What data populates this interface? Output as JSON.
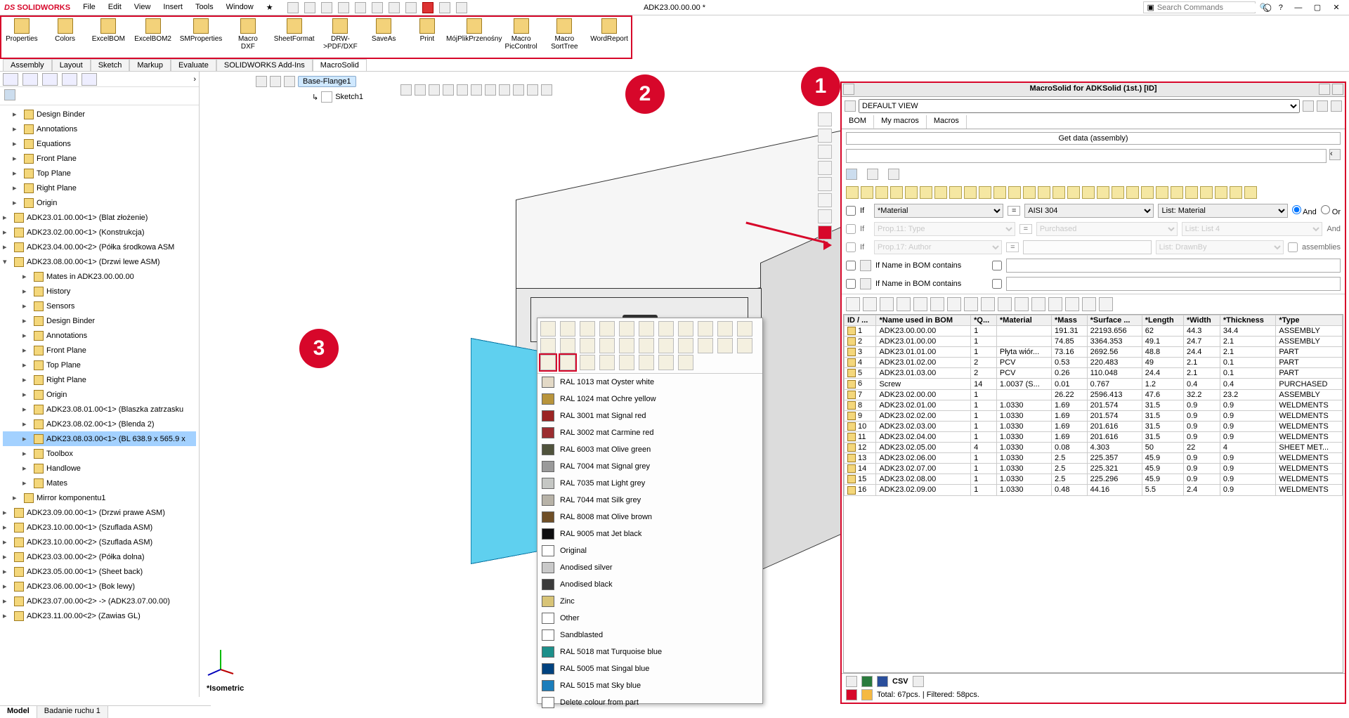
{
  "app": {
    "brand": "SOLIDWORKS",
    "menus": [
      "File",
      "Edit",
      "View",
      "Insert",
      "Tools",
      "Window"
    ],
    "docTitle": "ADK23.00.00.00 *",
    "searchPlaceholder": "Search Commands"
  },
  "macroToolbar": [
    "Properties",
    "Colors",
    "ExcelBOM",
    "ExcelBOM2",
    "SMProperties",
    "Macro DXF",
    "SheetFormat",
    "DRW->PDF/DXF",
    "SaveAs",
    "Print",
    "MójPlikPrzenośny",
    "Macro PicControl",
    "Macro SortTree",
    "WordReport"
  ],
  "cmdTabs": [
    "Assembly",
    "Layout",
    "Sketch",
    "Markup",
    "Evaluate",
    "SOLIDWORKS Add-Ins",
    "MacroSolid"
  ],
  "cmdTabActive": "MacroSolid",
  "breadcrumb": {
    "flange": "Base-Flange1",
    "sketch": "Sketch1"
  },
  "tree": [
    {
      "t": "Design Binder",
      "i": 1
    },
    {
      "t": "Annotations",
      "i": 1
    },
    {
      "t": "Equations",
      "i": 1
    },
    {
      "t": "Front Plane",
      "i": 1
    },
    {
      "t": "Top Plane",
      "i": 1
    },
    {
      "t": "Right Plane",
      "i": 1
    },
    {
      "t": "Origin",
      "i": 1
    },
    {
      "t": "ADK23.01.00.00<1> (Blat złożenie)",
      "i": 0
    },
    {
      "t": "ADK23.02.00.00<1> (Konstrukcja)",
      "i": 0
    },
    {
      "t": "ADK23.04.00.00<2> (Półka środkowa ASM",
      "i": 0
    },
    {
      "t": "ADK23.08.00.00<1> (Drzwi lewe ASM)",
      "i": 0,
      "open": true
    },
    {
      "t": "Mates in ADK23.00.00.00",
      "i": 2
    },
    {
      "t": "History",
      "i": 2
    },
    {
      "t": "Sensors",
      "i": 2
    },
    {
      "t": "Design Binder",
      "i": 2
    },
    {
      "t": "Annotations",
      "i": 2
    },
    {
      "t": "Front Plane",
      "i": 2
    },
    {
      "t": "Top Plane",
      "i": 2
    },
    {
      "t": "Right Plane",
      "i": 2
    },
    {
      "t": "Origin",
      "i": 2
    },
    {
      "t": "ADK23.08.01.00<1> (Blaszka zatrzasku",
      "i": 2
    },
    {
      "t": "ADK23.08.02.00<1> (Blenda 2)",
      "i": 2
    },
    {
      "t": "ADK23.08.03.00<1> (BL 638.9 x 565.9 x",
      "i": 2,
      "sel": true
    },
    {
      "t": "Toolbox",
      "i": 2
    },
    {
      "t": "Handlowe",
      "i": 2
    },
    {
      "t": "Mates",
      "i": 2
    },
    {
      "t": "Mirror komponentu1",
      "i": 1
    },
    {
      "t": "ADK23.09.00.00<1> (Drzwi prawe ASM)",
      "i": 0
    },
    {
      "t": "ADK23.10.00.00<1> (Szuflada ASM)",
      "i": 0
    },
    {
      "t": "ADK23.10.00.00<2> (Szuflada ASM)",
      "i": 0
    },
    {
      "t": "ADK23.03.00.00<2> (Półka dolna)",
      "i": 0
    },
    {
      "t": "ADK23.05.00.00<1> (Sheet back)",
      "i": 0
    },
    {
      "t": "ADK23.06.00.00<1> (Bok lewy)",
      "i": 0
    },
    {
      "t": "ADK23.07.00.00<2> -> (ADK23.07.00.00)",
      "i": 0
    },
    {
      "t": "ADK23.11.00.00<2> (Zawias GL)",
      "i": 0
    }
  ],
  "viewLabel": "*Isometric",
  "colors": [
    {
      "n": "RAL 1013 mat Oyster white",
      "c": "#e3d9c6"
    },
    {
      "n": "RAL 1024 mat Ochre yellow",
      "c": "#b8943b"
    },
    {
      "n": "RAL 3001 mat Signal red",
      "c": "#9b2423"
    },
    {
      "n": "RAL 3002 mat Carmine red",
      "c": "#9b2d30"
    },
    {
      "n": "RAL 6003 mat Olive green",
      "c": "#50533c"
    },
    {
      "n": "RAL 7004 mat Signal grey",
      "c": "#9a9a9a"
    },
    {
      "n": "RAL 7035 mat Light grey",
      "c": "#c5c7c4"
    },
    {
      "n": "RAL 7044 mat Silk grey",
      "c": "#b7b2a7"
    },
    {
      "n": "RAL 8008 mat Olive brown",
      "c": "#6f4f27"
    },
    {
      "n": "RAL 9005 mat Jet black",
      "c": "#0e0e10"
    },
    {
      "n": "Original",
      "c": "#ffffff"
    },
    {
      "n": "Anodised silver",
      "c": "#c9c9c9"
    },
    {
      "n": "Anodised black",
      "c": "#3a3a3a"
    },
    {
      "n": "Zinc",
      "c": "#d8c477"
    },
    {
      "n": "Other",
      "c": "#ffffff"
    },
    {
      "n": "Sandblasted",
      "c": "#ffffff"
    },
    {
      "n": "RAL 5018 mat Turquoise blue",
      "c": "#1c8f8a"
    },
    {
      "n": "RAL 5005 mat Singal blue",
      "c": "#00427f"
    },
    {
      "n": "RAL 5015 mat Sky blue",
      "c": "#1b7dbb"
    },
    {
      "n": "Delete colour from part",
      "c": "#ffffff"
    }
  ],
  "msPanel": {
    "title": "MacroSolid for ADKSolid (1st.) [ID]",
    "defaultView": "DEFAULT VIEW",
    "tabs": [
      "BOM",
      "My macros",
      "Macros"
    ],
    "tabActive": "BOM",
    "getData": "Get data (assembly)",
    "filters": {
      "f1": {
        "if": "If",
        "prop": "*Material",
        "op": "=",
        "val": "AISI 304",
        "list": "List: Material",
        "andOr": "And"
      },
      "f2": {
        "if": "If",
        "prop": "Prop.11: Type",
        "op": "=",
        "val": "Purchased",
        "list": "List: List 4",
        "and": "And"
      },
      "f3": {
        "if": "If",
        "prop": "Prop.17: Author",
        "op": "=",
        "val": "",
        "list": "List: DrawnBy",
        "asm": "assemblies"
      },
      "name1": "If Name in BOM contains",
      "name2": "If Name in BOM contains"
    },
    "cols": [
      "ID / ...",
      "*Name used in BOM",
      "*Q...",
      "*Material",
      "*Mass",
      "*Surface ...",
      "*Length",
      "*Width",
      "*Thickness",
      "*Type"
    ],
    "rows": [
      [
        "1",
        "ADK23.00.00.00",
        "1",
        "",
        "191.31",
        "22193.656",
        "62",
        "44.3",
        "34.4",
        "ASSEMBLY"
      ],
      [
        "2",
        "ADK23.01.00.00",
        "1",
        "",
        "74.85",
        "3364.353",
        "49.1",
        "24.7",
        "2.1",
        "ASSEMBLY"
      ],
      [
        "3",
        "ADK23.01.01.00",
        "1",
        "Płyta wiór...",
        "73.16",
        "2692.56",
        "48.8",
        "24.4",
        "2.1",
        "PART"
      ],
      [
        "4",
        "ADK23.01.02.00",
        "2",
        "PCV",
        "0.53",
        "220.483",
        "49",
        "2.1",
        "0.1",
        "PART"
      ],
      [
        "5",
        "ADK23.01.03.00",
        "2",
        "PCV",
        "0.26",
        "110.048",
        "24.4",
        "2.1",
        "0.1",
        "PART"
      ],
      [
        "6",
        "Screw",
        "14",
        "1.0037 (S...",
        "0.01",
        "0.767",
        "1.2",
        "0.4",
        "0.4",
        "PURCHASED"
      ],
      [
        "7",
        "ADK23.02.00.00",
        "1",
        "",
        "26.22",
        "2596.413",
        "47.6",
        "32.2",
        "23.2",
        "ASSEMBLY"
      ],
      [
        "8",
        "ADK23.02.01.00",
        "1",
        "1.0330",
        "1.69",
        "201.574",
        "31.5",
        "0.9",
        "0.9",
        "WELDMENTS"
      ],
      [
        "9",
        "ADK23.02.02.00",
        "1",
        "1.0330",
        "1.69",
        "201.574",
        "31.5",
        "0.9",
        "0.9",
        "WELDMENTS"
      ],
      [
        "10",
        "ADK23.02.03.00",
        "1",
        "1.0330",
        "1.69",
        "201.616",
        "31.5",
        "0.9",
        "0.9",
        "WELDMENTS"
      ],
      [
        "11",
        "ADK23.02.04.00",
        "1",
        "1.0330",
        "1.69",
        "201.616",
        "31.5",
        "0.9",
        "0.9",
        "WELDMENTS"
      ],
      [
        "12",
        "ADK23.02.05.00",
        "4",
        "1.0330",
        "0.08",
        "4.303",
        "50",
        "22",
        "4",
        "SHEET MET..."
      ],
      [
        "13",
        "ADK23.02.06.00",
        "1",
        "1.0330",
        "2.5",
        "225.357",
        "45.9",
        "0.9",
        "0.9",
        "WELDMENTS"
      ],
      [
        "14",
        "ADK23.02.07.00",
        "1",
        "1.0330",
        "2.5",
        "225.321",
        "45.9",
        "0.9",
        "0.9",
        "WELDMENTS"
      ],
      [
        "15",
        "ADK23.02.08.00",
        "1",
        "1.0330",
        "2.5",
        "225.296",
        "45.9",
        "0.9",
        "0.9",
        "WELDMENTS"
      ],
      [
        "16",
        "ADK23.02.09.00",
        "1",
        "1.0330",
        "0.48",
        "44.16",
        "5.5",
        "2.4",
        "0.9",
        "WELDMENTS"
      ]
    ],
    "csvLabel": "CSV",
    "totals": "Total: 67pcs. | Filtered: 58pcs."
  },
  "bottomTabs": [
    "Model",
    "Badanie ruchu 1"
  ],
  "bottomActive": "Model"
}
